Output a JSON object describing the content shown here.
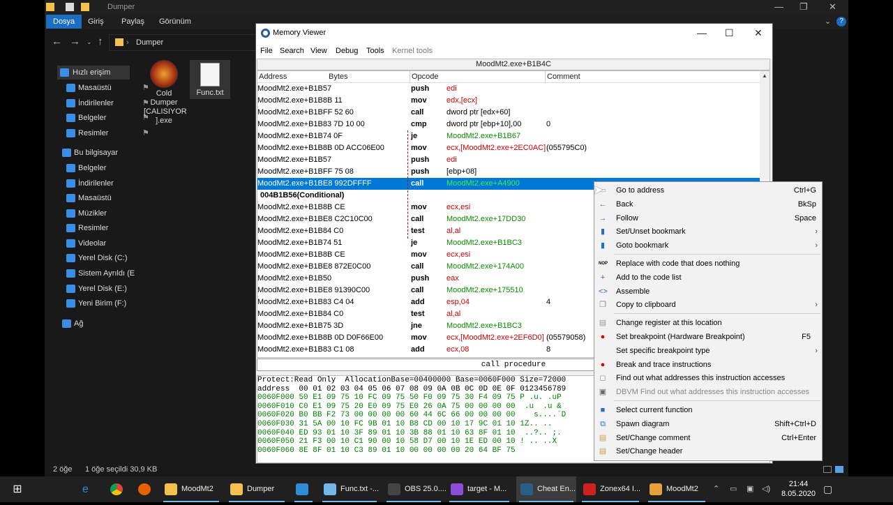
{
  "explorer": {
    "title": "Dumper",
    "ribbon_tabs": [
      "Dosya",
      "Giriş",
      "Paylaş",
      "Görünüm"
    ],
    "address": "Dumper",
    "sidebar": [
      {
        "label": "Hızlı erişim",
        "pinned": false
      },
      {
        "label": "Masaüstü",
        "pinned": true
      },
      {
        "label": "İndirilenler",
        "pinned": true
      },
      {
        "label": "Belgeler",
        "pinned": true
      },
      {
        "label": "Resimler",
        "pinned": true
      },
      {
        "label": "Bu bilgisayar",
        "pinned": false
      },
      {
        "label": "Belgeler",
        "pinned": false
      },
      {
        "label": "İndirilenler",
        "pinned": false
      },
      {
        "label": "Masaüstü",
        "pinned": false
      },
      {
        "label": "Müzikler",
        "pinned": false
      },
      {
        "label": "Resimler",
        "pinned": false
      },
      {
        "label": "Videolar",
        "pinned": false
      },
      {
        "label": "Yerel Disk (C:)",
        "pinned": false
      },
      {
        "label": "Sistem Ayrıldı (E",
        "pinned": false
      },
      {
        "label": "Yerel Disk (E:)",
        "pinned": false
      },
      {
        "label": "Yeni Birim (F:)",
        "pinned": false
      },
      {
        "label": "Ağ",
        "pinned": false
      }
    ],
    "files": [
      {
        "name": "Cold Dumper [CALISIYOR].exe",
        "lines": [
          "Cold",
          "Dumper",
          "[CALISIYOR",
          "].exe"
        ]
      },
      {
        "name": "Func.txt",
        "lines": [
          "Func.txt"
        ]
      }
    ],
    "status": {
      "count": "2 öğe",
      "selected": "1 öğe seçildi  30,9 KB"
    }
  },
  "memory_viewer": {
    "title": "Memory Viewer",
    "menu": [
      "File",
      "Search",
      "View",
      "Debug",
      "Tools",
      "Kernel tools"
    ],
    "current_address": "MoodMt2.exe+B1B4C",
    "columns": [
      "Address",
      "Bytes",
      "Opcode",
      "Comment"
    ],
    "rows": [
      {
        "addr": "MoodMt2.exe+B1B57",
        "op": "push",
        "param": "edi",
        "pc": "red",
        "comment": ""
      },
      {
        "addr": "MoodMt2.exe+B1B8B 11",
        "op": "mov",
        "param": "edx,[ecx]",
        "pc": "red",
        "comment": ""
      },
      {
        "addr": "MoodMt2.exe+B1BFF 52 60",
        "op": "call",
        "param": "dword ptr [edx+60]",
        "pc": "mix",
        "comment": ""
      },
      {
        "addr": "MoodMt2.exe+B1B83 7D 10 00",
        "op": "cmp",
        "param": "dword ptr [ebp+10],00",
        "pc": "mix",
        "comment": "0"
      },
      {
        "addr": "MoodMt2.exe+B1B74 0F",
        "op": "je",
        "param": "MoodMt2.exe+B1B67",
        "pc": "grn",
        "comment": ""
      },
      {
        "addr": "MoodMt2.exe+B1B8B 0D ACC06E00",
        "op": "mov",
        "param": "ecx,[MoodMt2.exe+2EC0AC]",
        "pc": "red",
        "comment": "(055795C0)"
      },
      {
        "addr": "MoodMt2.exe+B1B57",
        "op": "push",
        "param": "edi",
        "pc": "red",
        "comment": ""
      },
      {
        "addr": "MoodMt2.exe+B1BFF 75 08",
        "op": "push",
        "param": "[ebp+08]",
        "pc": "mix",
        "comment": ""
      },
      {
        "addr": "MoodMt2.exe+B1BE8 992DFFFF",
        "op": "call",
        "param": "MoodMt2.exe+A4900",
        "pc": "grn",
        "comment": "",
        "selected": true
      },
      {
        "addr": "004B1B56(Conditional)",
        "op": "",
        "param": "",
        "pc": "",
        "comment": "",
        "cond": true
      },
      {
        "addr": "MoodMt2.exe+B1B8B CE",
        "op": "mov",
        "param": "ecx,esi",
        "pc": "red",
        "comment": ""
      },
      {
        "addr": "MoodMt2.exe+B1BE8 C2C10C00",
        "op": "call",
        "param": "MoodMt2.exe+17DD30",
        "pc": "grn",
        "comment": ""
      },
      {
        "addr": "MoodMt2.exe+B1B84 C0",
        "op": "test",
        "param": "al,al",
        "pc": "red",
        "comment": ""
      },
      {
        "addr": "MoodMt2.exe+B1B74 51",
        "op": "je",
        "param": "MoodMt2.exe+B1BC3",
        "pc": "grn",
        "comment": ""
      },
      {
        "addr": "MoodMt2.exe+B1B8B CE",
        "op": "mov",
        "param": "ecx,esi",
        "pc": "red",
        "comment": ""
      },
      {
        "addr": "MoodMt2.exe+B1BE8 872E0C00",
        "op": "call",
        "param": "MoodMt2.exe+174A00",
        "pc": "grn",
        "comment": ""
      },
      {
        "addr": "MoodMt2.exe+B1B50",
        "op": "push",
        "param": "eax",
        "pc": "red",
        "comment": ""
      },
      {
        "addr": "MoodMt2.exe+B1BE8 91390C00",
        "op": "call",
        "param": "MoodMt2.exe+175510",
        "pc": "grn",
        "comment": ""
      },
      {
        "addr": "MoodMt2.exe+B1B83 C4 04",
        "op": "add",
        "param": "esp,04",
        "pc": "red",
        "comment": "4"
      },
      {
        "addr": "MoodMt2.exe+B1B84 C0",
        "op": "test",
        "param": "al,al",
        "pc": "red",
        "comment": ""
      },
      {
        "addr": "MoodMt2.exe+B1B75 3D",
        "op": "jne",
        "param": "MoodMt2.exe+B1BC3",
        "pc": "grn",
        "comment": ""
      },
      {
        "addr": "MoodMt2.exe+B1B8B 0D D0F66E00",
        "op": "mov",
        "param": "ecx,[MoodMt2.exe+2EF6D0]",
        "pc": "red",
        "comment": "(05579058)"
      },
      {
        "addr": "MoodMt2.exe+B1B83 C1 08",
        "op": "add",
        "param": "ecx,08",
        "pc": "red",
        "comment": "8"
      }
    ],
    "description": "call procedure",
    "hex_lines": [
      "Protect:Read Only  AllocationBase=00400000 Base=0060F000 Size=72000",
      "address  00 01 02 03 04 05 06 07 08 09 0A 0B 0C 0D 0E 0F 0123456789",
      "0060F000 50 E1 09 75 10 FC 09 75 50 F0 09 75 30 F4 09 75 P .u. .uP",
      "0060F010 C0 E1 09 75 20 E0 09 75 E0 26 0A 75 00 00 00 00  .u  .u &",
      "0060F020 B0 BB F2 73 00 00 00 00 60 44 6C 66 00 00 00 00    s....`D",
      "0060F030 31 5A 00 10 FC 9B 01 10 B8 CD 00 10 17 9C 01 10 1Z.. .. ",
      "0060F040 ED 93 01 10 3F 89 01 10 3B 88 01 10 63 8F 01 10  ..?.. ;.",
      "0060F050 21 F3 00 10 C1 90 00 10 58 D7 00 10 1E ED 00 10 ! .. ..X",
      "0060F060 8E 8F 01 10 C3 89 01 10 00 00 00 00 20 64 BF 75"
    ]
  },
  "context_menu": [
    {
      "label": "Go to address",
      "shortcut": "Ctrl+G",
      "icon": "goto-icon"
    },
    {
      "label": "Back",
      "shortcut": "BkSp",
      "icon": "back-arrow-icon"
    },
    {
      "label": "Follow",
      "shortcut": "Space",
      "icon": "follow-arrow-icon"
    },
    {
      "label": "Set/Unset bookmark",
      "submenu": true,
      "icon": "bookmark-icon"
    },
    {
      "label": "Goto bookmark",
      "submenu": true,
      "icon": "bookmark-goto-icon"
    },
    {
      "sep": true
    },
    {
      "label": "Replace with code that does nothing",
      "icon": "nop-icon"
    },
    {
      "label": "Add to the code list",
      "icon": "plus-icon"
    },
    {
      "label": "Assemble",
      "icon": "assemble-icon"
    },
    {
      "label": "Copy to clipboard",
      "submenu": true,
      "icon": "copy-icon"
    },
    {
      "sep": true
    },
    {
      "label": "Change register at this location",
      "icon": "register-icon"
    },
    {
      "label": "Set breakpoint (Hardware Breakpoint)",
      "shortcut": "F5",
      "icon": "breakpoint-icon"
    },
    {
      "label": "Set specific breakpoint type",
      "submenu": true,
      "icon": ""
    },
    {
      "label": "Break and trace instructions",
      "icon": "trace-icon"
    },
    {
      "label": "Find out what addresses this instruction accesses",
      "icon": "find-icon"
    },
    {
      "label": "DBVM Find out what addresses this instruction accesses",
      "icon": "dbvm-icon",
      "disabled": true
    },
    {
      "sep": true
    },
    {
      "label": "Select current function",
      "icon": "function-icon"
    },
    {
      "label": "Spawn diagram",
      "shortcut": "Shift+Ctrl+D",
      "icon": "diagram-icon"
    },
    {
      "label": "Set/Change comment",
      "shortcut": "Ctrl+Enter",
      "icon": "comment-icon"
    },
    {
      "label": "Set/Change header",
      "icon": "header-icon"
    }
  ],
  "taskbar": {
    "items": [
      {
        "label": "MoodMt2",
        "color": "#f2c14e"
      },
      {
        "label": "Dumper",
        "color": "#f2c14e"
      },
      {
        "label": "",
        "color": "#2f8dd6"
      },
      {
        "label": "Func.txt -...",
        "color": "#74b6e6"
      },
      {
        "label": "OBS 25.0....",
        "color": "#444"
      },
      {
        "label": "target - M...",
        "color": "#8a4fd6"
      },
      {
        "label": "Cheat En...",
        "color": "#2a5d8a",
        "active": true
      },
      {
        "label": "Zonex64 I...",
        "color": "#c22"
      },
      {
        "label": "MoodMt2",
        "color": "#e8a13a"
      }
    ],
    "time": "21:44",
    "date": "8.05.2020"
  }
}
